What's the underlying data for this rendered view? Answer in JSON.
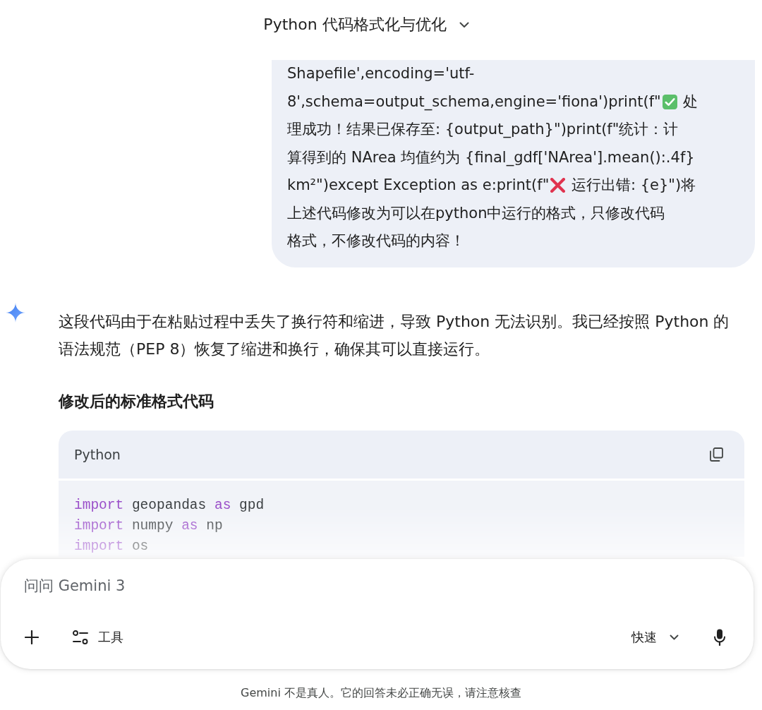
{
  "header": {
    "title": "Python 代码格式化与优化"
  },
  "user_message": {
    "lines": [
      {
        "segments": [
          {
            "kind": "text",
            "text": "Shapefile',encoding='utf-"
          }
        ]
      },
      {
        "segments": [
          {
            "kind": "text",
            "text": "8',schema=output_schema,engine='fiona')print(f\""
          },
          {
            "kind": "check"
          },
          {
            "kind": "text",
            "text": " 处"
          }
        ]
      },
      {
        "segments": [
          {
            "kind": "text",
            "text": "理成功！结果已保存至: {output_path}\")print(f\"统计：计"
          }
        ]
      },
      {
        "segments": [
          {
            "kind": "text",
            "text": "算得到的 NArea 均值约为 {final_gdf['NArea'].mean():.4f}"
          }
        ]
      },
      {
        "segments": [
          {
            "kind": "text",
            "text": "km²\")except Exception as e:print(f\""
          },
          {
            "kind": "cross"
          },
          {
            "kind": "text",
            "text": " 运行出错: {e}\")将"
          }
        ]
      },
      {
        "segments": [
          {
            "kind": "text",
            "text": "上述代码修改为可以在python中运行的格式，只修改代码"
          }
        ]
      },
      {
        "segments": [
          {
            "kind": "text",
            "text": "格式，不修改代码的内容！"
          }
        ]
      }
    ]
  },
  "response": {
    "paragraph": "这段代码由于在粘贴过程中丢失了换行符和缩进，导致 Python 无法识别。我已经按照 Python 的语法规范（PEP 8）恢复了缩进和换行，确保其可以直接运行。",
    "heading": "修改后的标准格式代码",
    "code_block": {
      "language": "Python",
      "lines": [
        {
          "tokens": [
            {
              "kind": "keyword",
              "text": "import"
            },
            {
              "kind": "plain",
              "text": " geopandas "
            },
            {
              "kind": "keyword",
              "text": "as"
            },
            {
              "kind": "plain",
              "text": " gpd"
            }
          ]
        },
        {
          "tokens": [
            {
              "kind": "keyword",
              "text": "import"
            },
            {
              "kind": "plain",
              "text": " numpy "
            },
            {
              "kind": "keyword",
              "text": "as"
            },
            {
              "kind": "plain",
              "text": " np"
            }
          ]
        },
        {
          "tokens": [
            {
              "kind": "keyword",
              "text": "import"
            },
            {
              "kind": "plain",
              "text": " os"
            }
          ]
        }
      ]
    }
  },
  "composer": {
    "placeholder": "问问 Gemini 3",
    "tools_label": "工具",
    "mode_label": "快速"
  },
  "footer": {
    "disclaimer": "Gemini 不是真人。它的回答未必正确无误，请注意核查"
  }
}
